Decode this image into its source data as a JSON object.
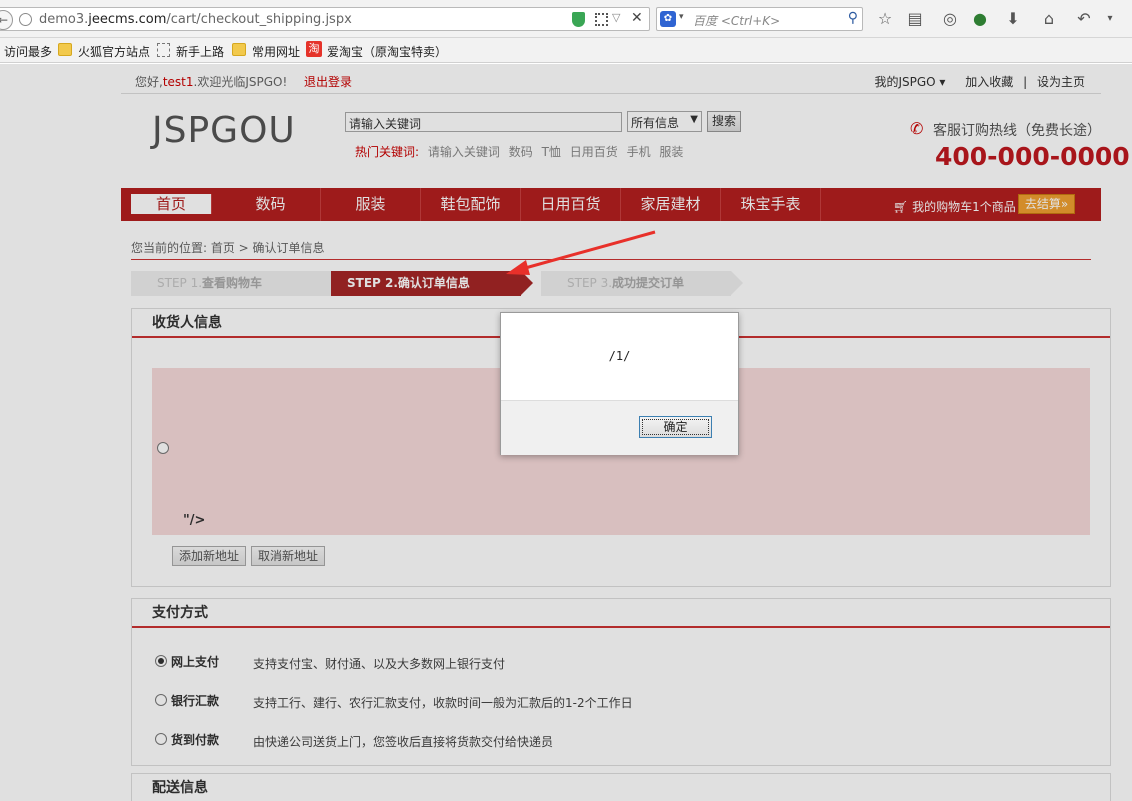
{
  "browser": {
    "url_prefix": "demo3.",
    "url_domain": "jeecms.com",
    "url_path": "/cart/checkout_shipping.jspx",
    "search_placeholder": "百度 <Ctrl+K>",
    "bookmarks": [
      "访问最多",
      "火狐官方站点",
      "新手上路",
      "常用网址",
      "爱淘宝（原淘宝特卖）"
    ]
  },
  "topbar": {
    "greeting_pre": "您好,",
    "username": "test1",
    "greeting_post": ".欢迎光临JSPGO!",
    "logout": "退出登录",
    "my_account": "我的JSPGO ▾",
    "favorite": "加入收藏",
    "separator": "|",
    "homepage": "设为主页"
  },
  "header": {
    "logo": "JSPGOU",
    "search_value": "请输入关键词",
    "search_scope": "所有信息",
    "search_button": "搜索",
    "hot_label": "热门关键词:",
    "hot_keywords": [
      "请输入关键词",
      "数码",
      "T恤",
      "日用百货",
      "手机",
      "服装"
    ],
    "hotline_label": "客服订购热线（免费长途）",
    "hotline_number": "400-000-0000"
  },
  "nav": {
    "items": [
      "首页",
      "数码",
      "服装",
      "鞋包配饰",
      "日用百货",
      "家居建材",
      "珠宝手表"
    ],
    "cart_text": "我的购物车1个商品",
    "checkout": "去结算»"
  },
  "breadcrumb": "您当前的位置: 首页 > 确认订单信息",
  "steps": [
    {
      "num": "STEP 1.",
      "label": "查看购物车"
    },
    {
      "num": "STEP 2.",
      "label": "确认订单信息"
    },
    {
      "num": "STEP 3.",
      "label": "成功提交订单"
    }
  ],
  "receiver": {
    "title": "收货人信息",
    "injected_text": "\"/>",
    "add_address": "添加新地址",
    "cancel_address": "取消新地址"
  },
  "payment": {
    "title": "支付方式",
    "options": [
      {
        "name": "网上支付",
        "desc": "支持支付宝、财付通、以及大多数网上银行支付",
        "selected": true
      },
      {
        "name": "银行汇款",
        "desc": "支持工行、建行、农行汇款支付，收款时间一般为汇款后的1-2个工作日",
        "selected": false
      },
      {
        "name": "货到付款",
        "desc": "由快递公司送货上门，您签收后直接将货款交付给快递员",
        "selected": false
      }
    ]
  },
  "delivery": {
    "title": "配送信息"
  },
  "dialog": {
    "message": "/1/",
    "ok": "确定"
  }
}
